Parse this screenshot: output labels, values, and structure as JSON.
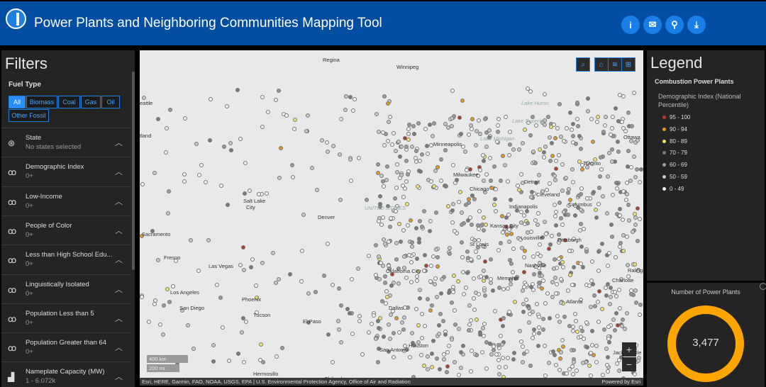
{
  "header": {
    "title": "Power Plants and Neighboring Communities Mapping Tool",
    "buttons": [
      {
        "icon": "info-icon",
        "glyph": "i"
      },
      {
        "icon": "mail-icon",
        "glyph": "✉"
      },
      {
        "icon": "share-icon",
        "glyph": "⚲"
      },
      {
        "icon": "download-icon",
        "glyph": "⤓"
      }
    ]
  },
  "filters": {
    "title": "Filters",
    "fuel_type_label": "Fuel Type",
    "fuel_types": [
      "All",
      "Biomass",
      "Coal",
      "Gas",
      "Oil",
      "Other Fossil"
    ],
    "items": [
      {
        "label": "State",
        "value": "No states selected"
      },
      {
        "label": "Demographic Index",
        "value": "0+"
      },
      {
        "label": "Low-Income",
        "value": "0+"
      },
      {
        "label": "People of Color",
        "value": "0+"
      },
      {
        "label": "Less than High School Edu...",
        "value": "0+"
      },
      {
        "label": "Linguistically Isolated",
        "value": "0+"
      },
      {
        "label": "Population Less than 5",
        "value": "0+"
      },
      {
        "label": "Population Greater than 64",
        "value": "0+"
      },
      {
        "label": "Nameplate Capacity (MW)",
        "value": "1 - 6.072k"
      }
    ]
  },
  "map": {
    "labels": [
      "Regina",
      "Winnipeg",
      "eattle",
      "tland",
      "Salt Lake",
      "City",
      "Denver",
      "Las Vegas",
      "Sacramento",
      "Fresno",
      "Los Angeles",
      "San Diego",
      "Phoenix",
      "Tucson",
      "El Paso",
      "Minneapolis",
      "Milwaukee",
      "Chicago",
      "Detroit",
      "Toronto",
      "Ottawa",
      "Cleveland",
      "Pittsburgh",
      "Columbus",
      "Indianapolis",
      "Kansas City",
      "St Louis",
      "Louisville",
      "Nashville",
      "Memphis",
      "Oklahoma City",
      "Dallas",
      "Houston",
      "San Antonio",
      "Atlanta",
      "Charlotte",
      "Raleigh",
      "Jacksonville",
      "Hermosillo",
      "Chihuahua",
      "Lake Superior",
      "Lake Huron",
      "Lake Michigan",
      "UNITED STATES"
    ],
    "scale_km": "400 km",
    "scale_mi": "200 mi",
    "zoom_in": "+",
    "zoom_out": "−",
    "attribution": "Esri, HERE, Garmin, FAO, NOAA, USGS, EPA | U.S. Environmental Protection Agency, Office of Air and Radiation",
    "powered_by": "Powered by Esri"
  },
  "legend": {
    "title": "Legend",
    "layer": "Combustion Power Plants",
    "subtitle": "Demographic Index (National Percentile)",
    "classes": [
      {
        "label": "95 - 100",
        "color": "#b5392c"
      },
      {
        "label": "90 - 94",
        "color": "#e39a1c"
      },
      {
        "label": "80 - 89",
        "color": "#f0e46a"
      },
      {
        "label": "70 - 79",
        "color": "#7a7a7a"
      },
      {
        "label": "60 - 69",
        "color": "#9a9a9a"
      },
      {
        "label": "50 - 59",
        "color": "#c8c8c8"
      },
      {
        "label": "0 - 49",
        "color": "#f4f4f4"
      }
    ]
  },
  "count": {
    "title": "Number of Power Plants",
    "value": "3,477",
    "color": "#ffa500"
  }
}
